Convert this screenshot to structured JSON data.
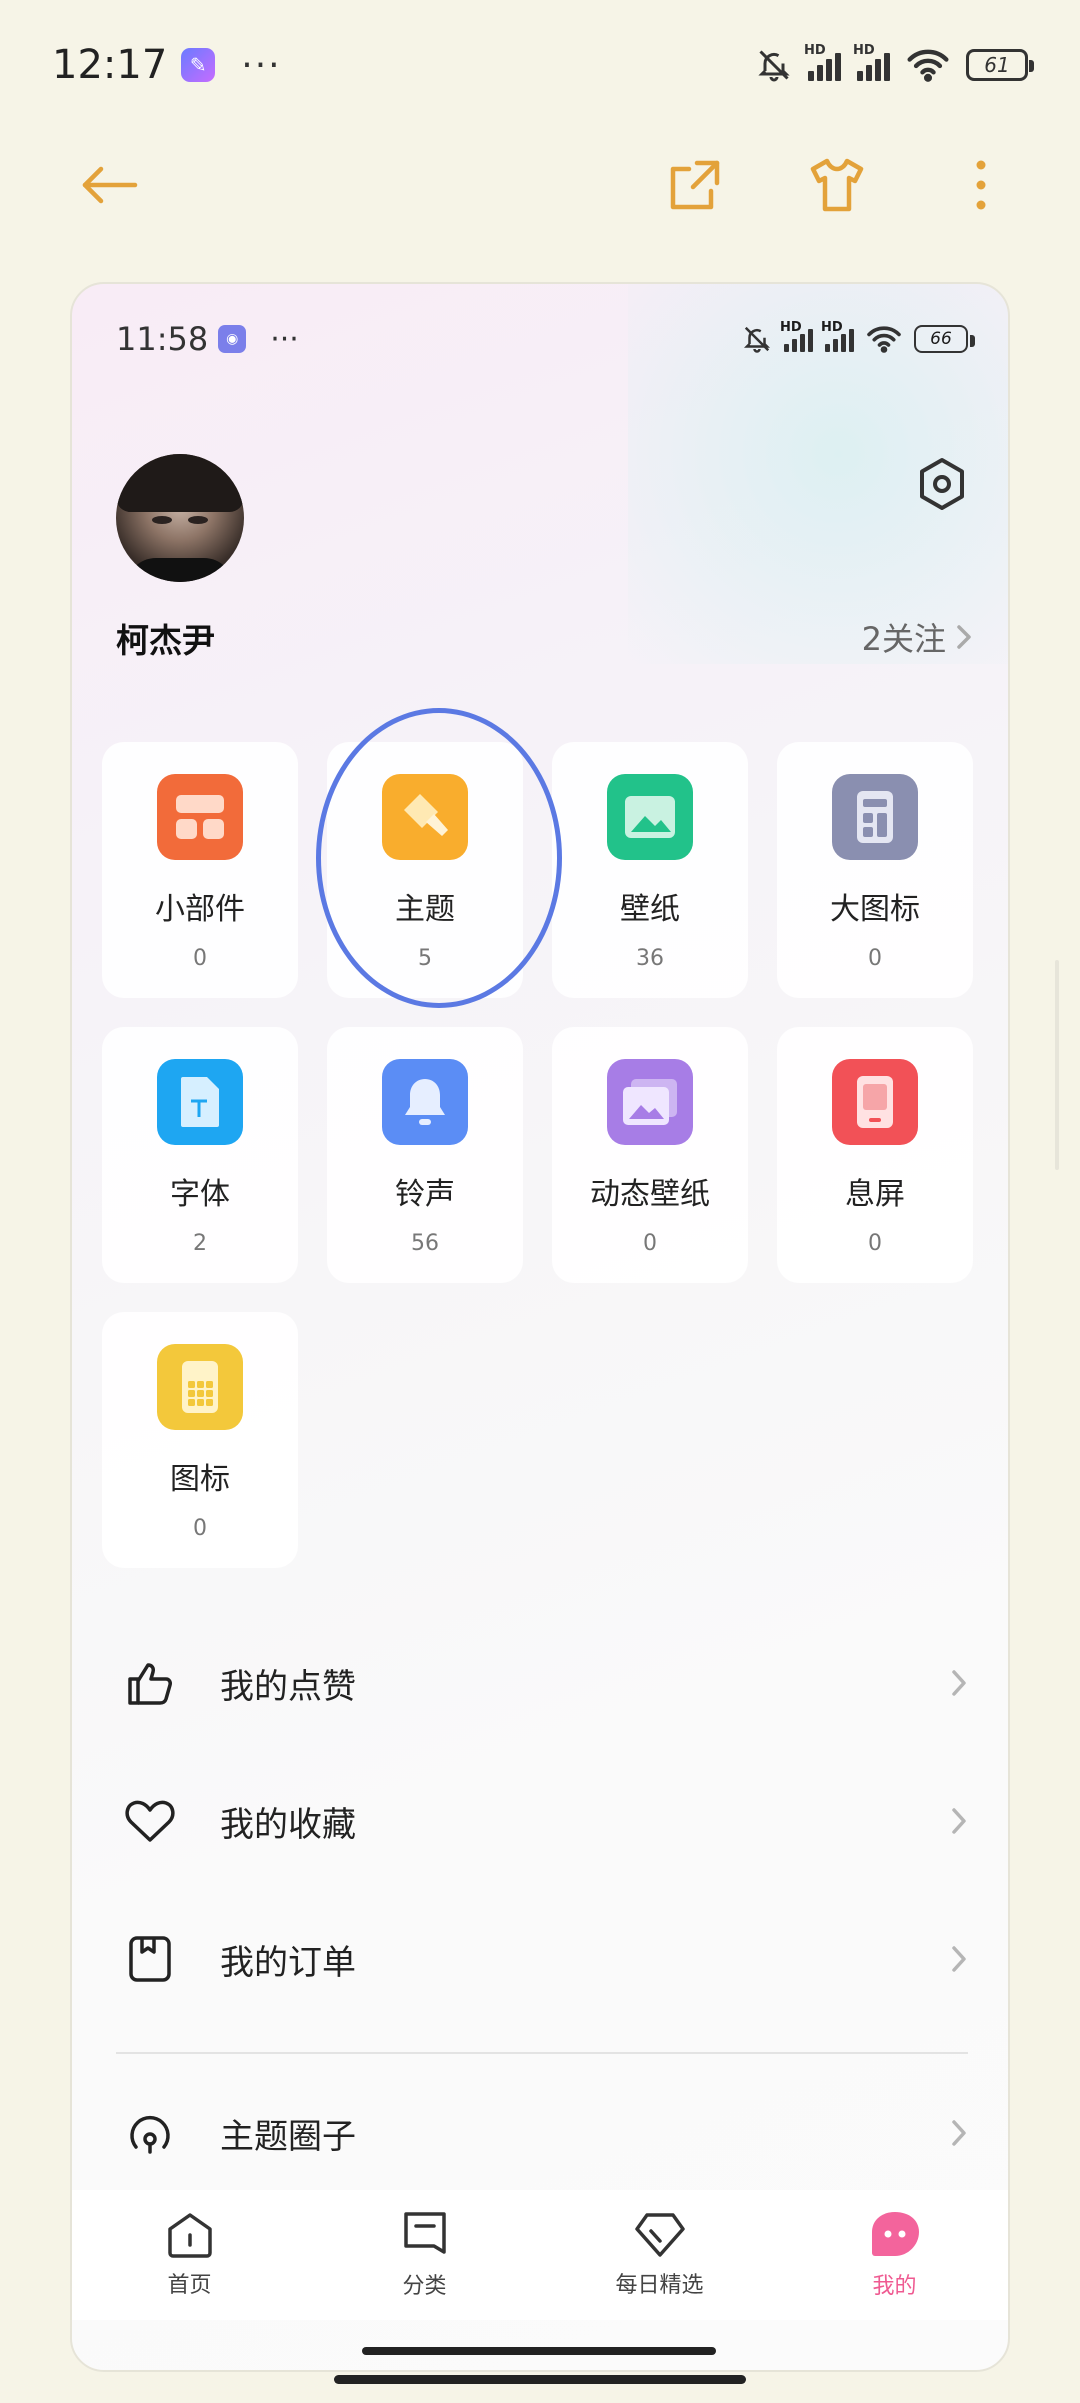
{
  "outer_status": {
    "time": "12:17",
    "battery": "61",
    "signal_label": "HD"
  },
  "inner_status": {
    "time": "11:58",
    "battery": "66",
    "signal_label": "HD"
  },
  "profile": {
    "username": "柯杰尹",
    "follow_text": "2关注"
  },
  "tiles": [
    {
      "label": "小部件",
      "count": "0",
      "color": "#f26b3a",
      "icon": "widget-icon"
    },
    {
      "label": "主题",
      "count": "5",
      "color": "#f9ad2d",
      "icon": "theme-brush-icon"
    },
    {
      "label": "壁纸",
      "count": "36",
      "color": "#22c28a",
      "icon": "wallpaper-icon"
    },
    {
      "label": "大图标",
      "count": "0",
      "color": "#8a8fb0",
      "icon": "large-icon-icon"
    },
    {
      "label": "字体",
      "count": "2",
      "color": "#1ea6f2",
      "icon": "font-icon"
    },
    {
      "label": "铃声",
      "count": "56",
      "color": "#5b8df5",
      "icon": "bell-icon"
    },
    {
      "label": "动态壁纸",
      "count": "0",
      "color": "#a77de6",
      "icon": "live-wallpaper-icon"
    },
    {
      "label": "息屏",
      "count": "0",
      "color": "#f25157",
      "icon": "aod-icon"
    },
    {
      "label": "图标",
      "count": "0",
      "color": "#f3c83b",
      "icon": "app-icon-icon"
    }
  ],
  "menu": [
    {
      "label": "我的点赞",
      "icon": "thumbs-up-icon"
    },
    {
      "label": "我的收藏",
      "icon": "heart-icon"
    },
    {
      "label": "我的订单",
      "icon": "order-icon"
    },
    {
      "label": "主题圈子",
      "icon": "community-icon"
    }
  ],
  "bottom_nav": [
    {
      "label": "首页",
      "icon": "home-icon"
    },
    {
      "label": "分类",
      "icon": "category-icon"
    },
    {
      "label": "每日精选",
      "icon": "diamond-icon"
    },
    {
      "label": "我的",
      "icon": "profile-icon",
      "active": true
    }
  ],
  "colors": {
    "accent": "#e3a23a",
    "highlight_ring": "#5b79e3",
    "active_nav": "#ef5a91"
  }
}
